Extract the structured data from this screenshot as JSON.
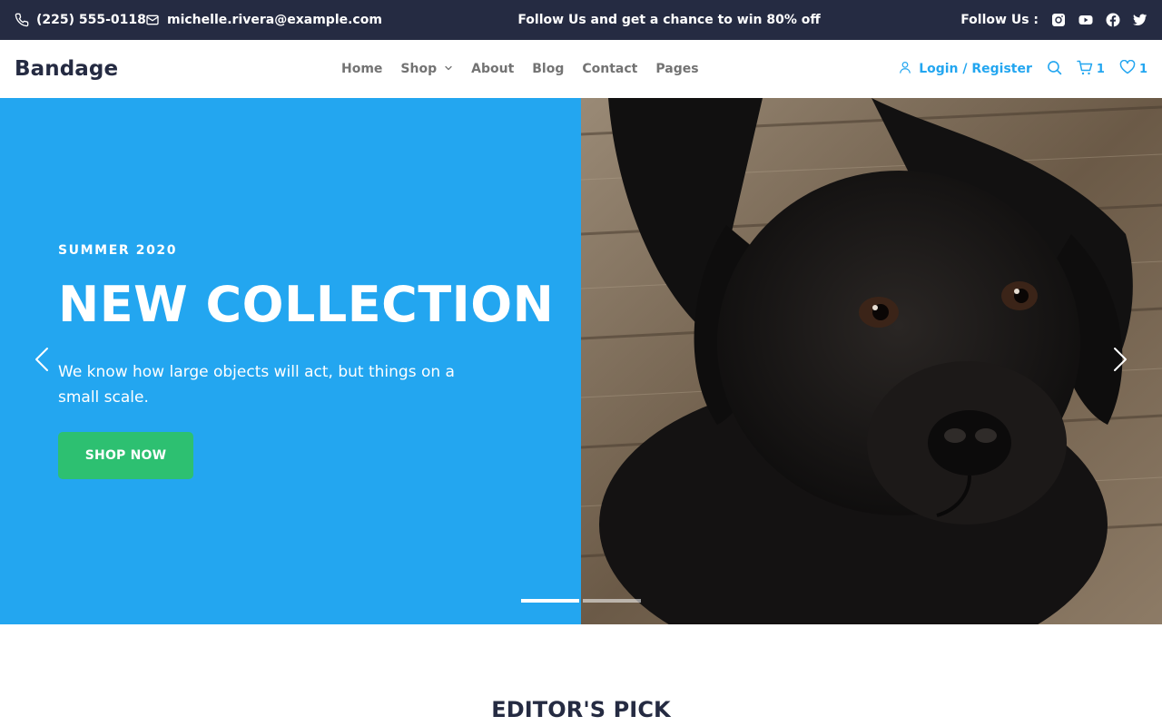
{
  "topbar": {
    "phone": "(225) 555-0118",
    "email": "michelle.rivera@example.com",
    "promo": "Follow Us and get a chance to win 80% off",
    "follow_label": "Follow Us :",
    "socials": [
      "instagram-icon",
      "youtube-icon",
      "facebook-icon",
      "twitter-icon"
    ],
    "background": "#252B42"
  },
  "navbar": {
    "brand": "Bandage",
    "menu": [
      {
        "label": "Home"
      },
      {
        "label": "Shop"
      },
      {
        "label": "About"
      },
      {
        "label": "Blog"
      },
      {
        "label": "Contact"
      },
      {
        "label": "Pages"
      }
    ],
    "login": "Login / Register",
    "cart_count": "1",
    "wishlist_count": "1",
    "accent": "#23A6F0"
  },
  "hero": {
    "eyebrow": "SUMMER 2020",
    "headline": "NEW COLLECTION",
    "description": "We know how large objects will act, but things on a small scale.",
    "cta": "SHOP NOW",
    "background": "#23A6F0",
    "cta_color": "#2DC071",
    "slides_total": 2,
    "active_slide": 1
  },
  "editors_pick": {
    "title": "EDITOR'S PICK"
  }
}
